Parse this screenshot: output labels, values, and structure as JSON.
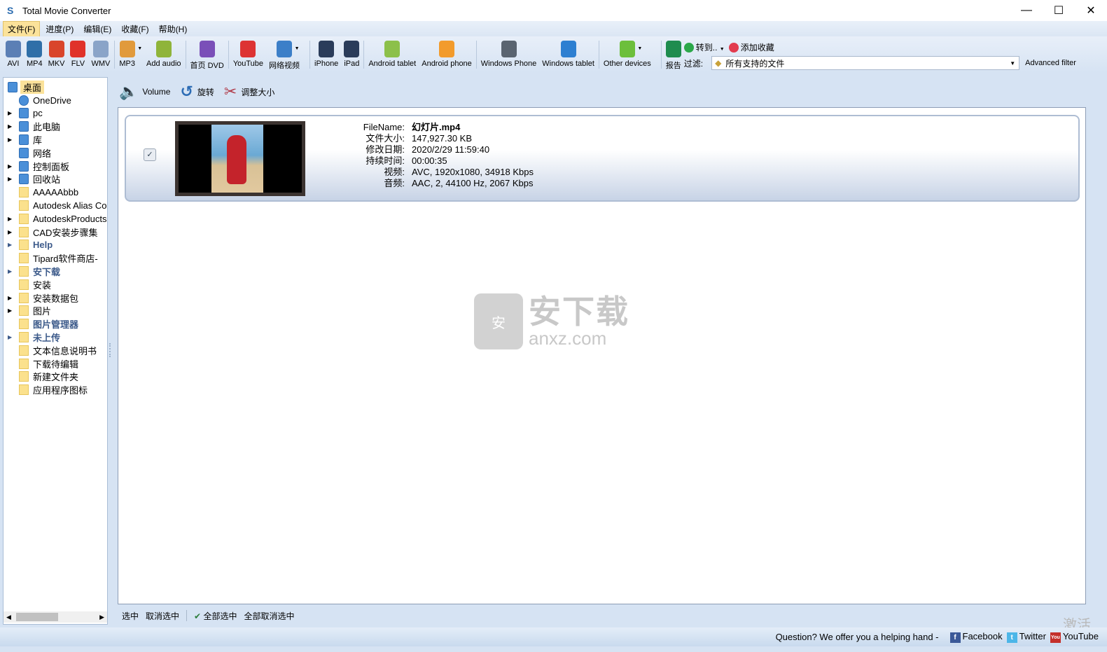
{
  "window": {
    "title": "Total Movie Converter",
    "minimize": "—",
    "maximize": "☐",
    "close": "✕"
  },
  "menu": [
    "文件(F)",
    "进度(P)",
    "编辑(E)",
    "收藏(F)",
    "帮助(H)"
  ],
  "toolbar": {
    "buttons": [
      {
        "label": "AVI",
        "icon": "avi-icon",
        "color": "#5b7fb5"
      },
      {
        "label": "MP4",
        "icon": "eye-icon",
        "color": "#2f6fa8"
      },
      {
        "label": "MKV",
        "icon": "matryoshka-icon",
        "color": "#d9452b"
      },
      {
        "label": "FLV",
        "icon": "flash-icon",
        "color": "#e0322a"
      },
      {
        "label": "WMV",
        "icon": "wmv-icon",
        "color": "#8aa4c8"
      },
      {
        "label": "MP3",
        "icon": "music-note-icon",
        "color": "#e19a3c",
        "dropdown": true
      },
      {
        "label": "Add audio",
        "icon": "add-audio-icon",
        "color": "#8fb43a"
      },
      {
        "label": "首页 DVD",
        "icon": "dvd-icon",
        "color": "#7a4fb8"
      },
      {
        "label": "YouTube",
        "icon": "youtube-icon",
        "color": "#d33"
      },
      {
        "label": "网络视频",
        "icon": "web-video-icon",
        "color": "#3c7fc8",
        "dropdown": true
      },
      {
        "label": "iPhone",
        "icon": "iphone-icon",
        "color": "#2a3c5a"
      },
      {
        "label": "iPad",
        "icon": "ipad-icon",
        "color": "#2a3c5a"
      },
      {
        "label": "Android tablet",
        "icon": "android-icon",
        "color": "#8cc04a"
      },
      {
        "label": "Android phone",
        "icon": "android-phone-icon",
        "color": "#f29b2c"
      },
      {
        "label": "Windows Phone",
        "icon": "windows-phone-icon",
        "color": "#5a6470"
      },
      {
        "label": "Windows tablet",
        "icon": "windows-logo-icon",
        "color": "#2d7fd1"
      },
      {
        "label": "Other devices",
        "icon": "device-icon",
        "color": "#6cbf3c",
        "dropdown": true
      },
      {
        "label": "报告",
        "icon": "report-icon",
        "color": "#1e8c4e"
      }
    ],
    "goto": "转到..",
    "favorite": "添加收藏",
    "filter_label": "过滤:",
    "filter_value": "所有支持的文件",
    "advanced_filter": "Advanced filter"
  },
  "sidebar": {
    "items": [
      {
        "label": "桌面",
        "expander": false,
        "icon": "desktop-icon",
        "selected": true
      },
      {
        "label": "OneDrive",
        "expander": false,
        "icon": "cloud-icon"
      },
      {
        "label": "pc",
        "expander": true,
        "icon": "user-icon"
      },
      {
        "label": "此电脑",
        "expander": true,
        "icon": "computer-icon"
      },
      {
        "label": "库",
        "expander": true,
        "icon": "library-icon"
      },
      {
        "label": "网络",
        "expander": false,
        "icon": "network-icon"
      },
      {
        "label": "控制面板",
        "expander": true,
        "icon": "control-panel-icon"
      },
      {
        "label": "回收站",
        "expander": true,
        "icon": "recycle-bin-icon"
      },
      {
        "label": "AAAAAbbb",
        "expander": false,
        "icon": "folder-icon"
      },
      {
        "label": "Autodesk Alias Co",
        "expander": false,
        "icon": "folder-icon"
      },
      {
        "label": "AutodeskProducts",
        "expander": true,
        "icon": "folder-icon"
      },
      {
        "label": "CAD安装步骤集",
        "expander": true,
        "icon": "folder-icon"
      },
      {
        "label": "Help",
        "expander": true,
        "icon": "folder-icon",
        "bold": true
      },
      {
        "label": "Tipard软件商店-",
        "expander": false,
        "icon": "folder-icon"
      },
      {
        "label": "安下载",
        "expander": true,
        "icon": "folder-icon",
        "bold": true
      },
      {
        "label": "安装",
        "expander": false,
        "icon": "folder-icon"
      },
      {
        "label": "安装数据包",
        "expander": true,
        "icon": "folder-icon"
      },
      {
        "label": "图片",
        "expander": true,
        "icon": "folder-icon"
      },
      {
        "label": "图片管理器",
        "expander": false,
        "icon": "folder-icon",
        "bold": true
      },
      {
        "label": "未上传",
        "expander": true,
        "icon": "folder-icon",
        "bold": true
      },
      {
        "label": "文本信息说明书",
        "expander": false,
        "icon": "folder-icon"
      },
      {
        "label": "下载待编辑",
        "expander": false,
        "icon": "folder-icon"
      },
      {
        "label": "新建文件夹",
        "expander": false,
        "icon": "folder-icon"
      },
      {
        "label": "应用程序图标",
        "expander": false,
        "icon": "folder-icon"
      }
    ]
  },
  "subtoolbar": {
    "volume": "Volume",
    "rotate": "旋转",
    "resize": "调整大小"
  },
  "file": {
    "checked": true,
    "rows": [
      {
        "key": "FileName:",
        "value": "幻灯片.mp4"
      },
      {
        "key": "文件大小:",
        "value": "147,927.30 KB"
      },
      {
        "key": "修改日期:",
        "value": "2020/2/29 11:59:40"
      },
      {
        "key": "持续时间:",
        "value": "00:00:35"
      },
      {
        "key": "视频:",
        "value": "AVC, 1920x1080, 34918 Kbps"
      },
      {
        "key": "音频:",
        "value": "AAC, 2, 44100 Hz, 2067 Kbps"
      }
    ]
  },
  "watermark": {
    "text1": "安下载",
    "text2": "anxz.com",
    "badge": "安"
  },
  "bottombar": {
    "select": "选中",
    "deselect": "取消选中",
    "select_all": "全部选中",
    "deselect_all": "全部取消选中"
  },
  "statusbar": {
    "question": "Question? We offer you a helping hand -",
    "facebook": "Facebook",
    "twitter": "Twitter",
    "youtube": "YouTube"
  },
  "activation": "激活"
}
